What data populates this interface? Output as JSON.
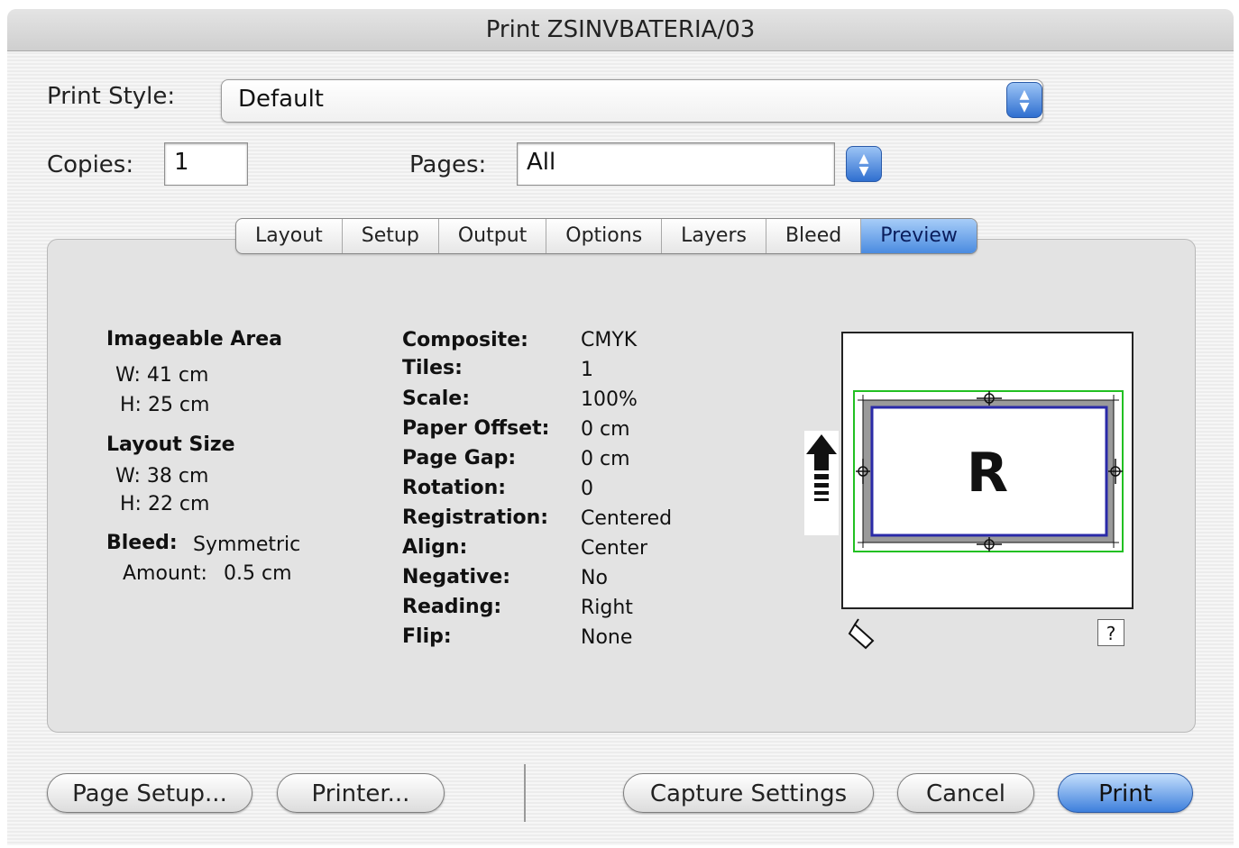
{
  "window": {
    "title": "Print ZSINVBATERIA/03"
  },
  "print_style": {
    "label": "Print Style:",
    "value": "Default"
  },
  "copies": {
    "label": "Copies:",
    "value": "1"
  },
  "pages": {
    "label": "Pages:",
    "value": "All"
  },
  "tabs": [
    {
      "label": "Layout",
      "active": false
    },
    {
      "label": "Setup",
      "active": false
    },
    {
      "label": "Output",
      "active": false
    },
    {
      "label": "Options",
      "active": false
    },
    {
      "label": "Layers",
      "active": false
    },
    {
      "label": "Bleed",
      "active": false
    },
    {
      "label": "Preview",
      "active": true
    }
  ],
  "imageable_area": {
    "heading": "Imageable Area",
    "w": "W: 41 cm",
    "h": "H: 25 cm"
  },
  "layout_size": {
    "heading": "Layout Size",
    "w": "W: 38 cm",
    "h": "H: 22 cm"
  },
  "bleed": {
    "label": "Bleed:",
    "value": "Symmetric",
    "amount_label": "Amount:",
    "amount_value": "0.5 cm"
  },
  "details": [
    {
      "label": "Composite:",
      "value": "CMYK"
    },
    {
      "label": "Tiles:",
      "value": "1"
    },
    {
      "label": "Scale:",
      "value": "100%"
    },
    {
      "label": "Paper Offset:",
      "value": "0 cm"
    },
    {
      "label": "Page Gap:",
      "value": "0 cm"
    },
    {
      "label": "Rotation:",
      "value": "0"
    },
    {
      "label": "Registration:",
      "value": "Centered"
    },
    {
      "label": "Align:",
      "value": "Center"
    },
    {
      "label": "Negative:",
      "value": "No"
    },
    {
      "label": "Reading:",
      "value": "Right"
    },
    {
      "label": "Flip:",
      "value": "None"
    }
  ],
  "preview": {
    "page_letter": "R",
    "help_label": "?"
  },
  "buttons": {
    "page_setup": "Page Setup...",
    "printer": "Printer...",
    "capture_settings": "Capture Settings",
    "cancel": "Cancel",
    "print": "Print"
  },
  "colors": {
    "accent": "#3d7fdc",
    "preview_green": "#22c022",
    "preview_blue": "#2a2aa8"
  }
}
